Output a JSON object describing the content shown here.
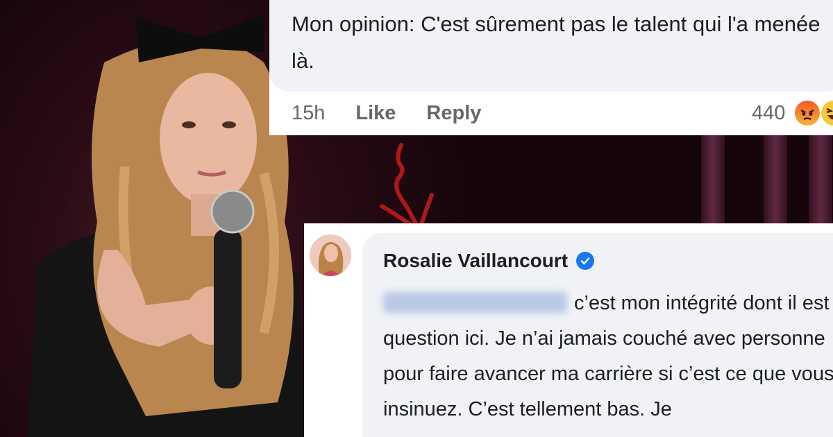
{
  "comment_top": {
    "text": "Mon opinion: C'est sûrement pas le talent qui l'a menée là.",
    "time": "15h",
    "like_label": "Like",
    "reply_label": "Reply",
    "reaction_count": "440",
    "reaction_icons": [
      "angry-emoji",
      "haha-emoji"
    ]
  },
  "comment_reply": {
    "author": "Rosalie Vaillancourt",
    "verified": true,
    "text": "c’est mon intégrité dont il est question ici. Je n’ai jamais couché avec personne pour faire avancer ma carrière si c’est ce que vous insinuez. C’est tellement bas. Je"
  },
  "colors": {
    "bubble": "#f0f2f5",
    "meta_text": "#65676b",
    "verified_badge": "#1877f2",
    "arrow": "#b01818"
  }
}
